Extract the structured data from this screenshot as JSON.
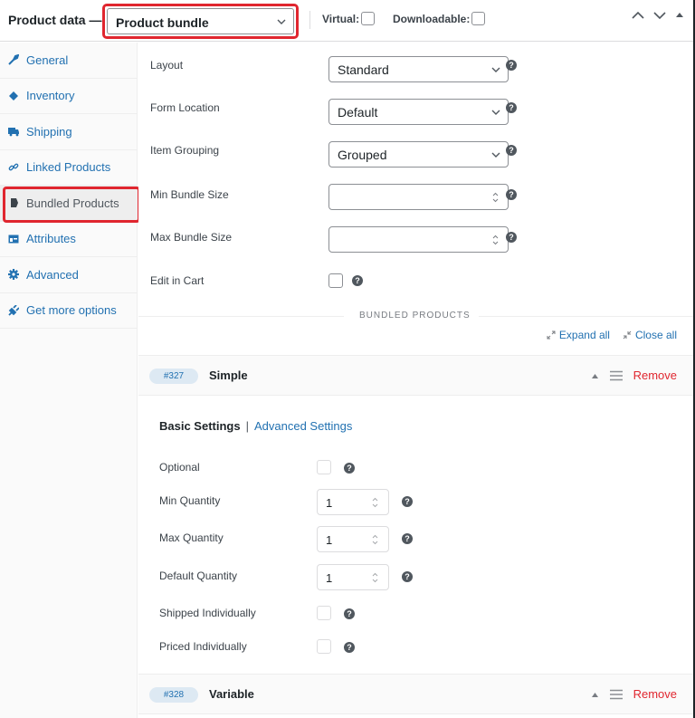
{
  "header": {
    "title": "Product data —",
    "product_type": "Product bundle",
    "virtual_label": "Virtual:",
    "virtual_checked": false,
    "downloadable_label": "Downloadable:",
    "downloadable_checked": false
  },
  "sidebar": {
    "items": [
      {
        "label": "General",
        "icon": "wrench-icon",
        "active": false
      },
      {
        "label": "Inventory",
        "icon": "tag-icon",
        "active": false
      },
      {
        "label": "Shipping",
        "icon": "truck-icon",
        "active": false
      },
      {
        "label": "Linked Products",
        "icon": "link-icon",
        "active": false
      },
      {
        "label": "Bundled Products",
        "icon": "bundle-icon",
        "active": true
      },
      {
        "label": "Attributes",
        "icon": "table-icon",
        "active": false
      },
      {
        "label": "Advanced",
        "icon": "gear-icon",
        "active": false
      },
      {
        "label": "Get more options",
        "icon": "plugin-icon",
        "active": false
      }
    ]
  },
  "bundle_settings": {
    "layout": {
      "label": "Layout",
      "value": "Standard"
    },
    "form_location": {
      "label": "Form Location",
      "value": "Default"
    },
    "item_grouping": {
      "label": "Item Grouping",
      "value": "Grouped"
    },
    "min_bundle_size": {
      "label": "Min Bundle Size",
      "value": ""
    },
    "max_bundle_size": {
      "label": "Max Bundle Size",
      "value": ""
    },
    "edit_in_cart": {
      "label": "Edit in Cart",
      "checked": false
    }
  },
  "bundled_products_section": {
    "title": "BUNDLED PRODUCTS",
    "expand_all": "Expand all",
    "close_all": "Close all"
  },
  "bundled_items": [
    {
      "id": "#327",
      "type": "Simple",
      "remove_label": "Remove",
      "tabs": {
        "basic": "Basic Settings",
        "separator": "|",
        "advanced": "Advanced Settings"
      },
      "fields": {
        "optional": {
          "label": "Optional",
          "checked": false
        },
        "min_quantity": {
          "label": "Min Quantity",
          "value": "1"
        },
        "max_quantity": {
          "label": "Max Quantity",
          "value": "1"
        },
        "default_quantity": {
          "label": "Default Quantity",
          "value": "1"
        },
        "shipped_individually": {
          "label": "Shipped Individually",
          "checked": false
        },
        "priced_individually": {
          "label": "Priced Individually",
          "checked": false
        }
      }
    },
    {
      "id": "#328",
      "type": "Variable",
      "remove_label": "Remove"
    }
  ],
  "help_glyph": "?",
  "colors": {
    "link": "#2271b1",
    "remove": "#e0262f",
    "highlight_border": "#e0262f",
    "id_badge_bg": "#dde9f3"
  }
}
